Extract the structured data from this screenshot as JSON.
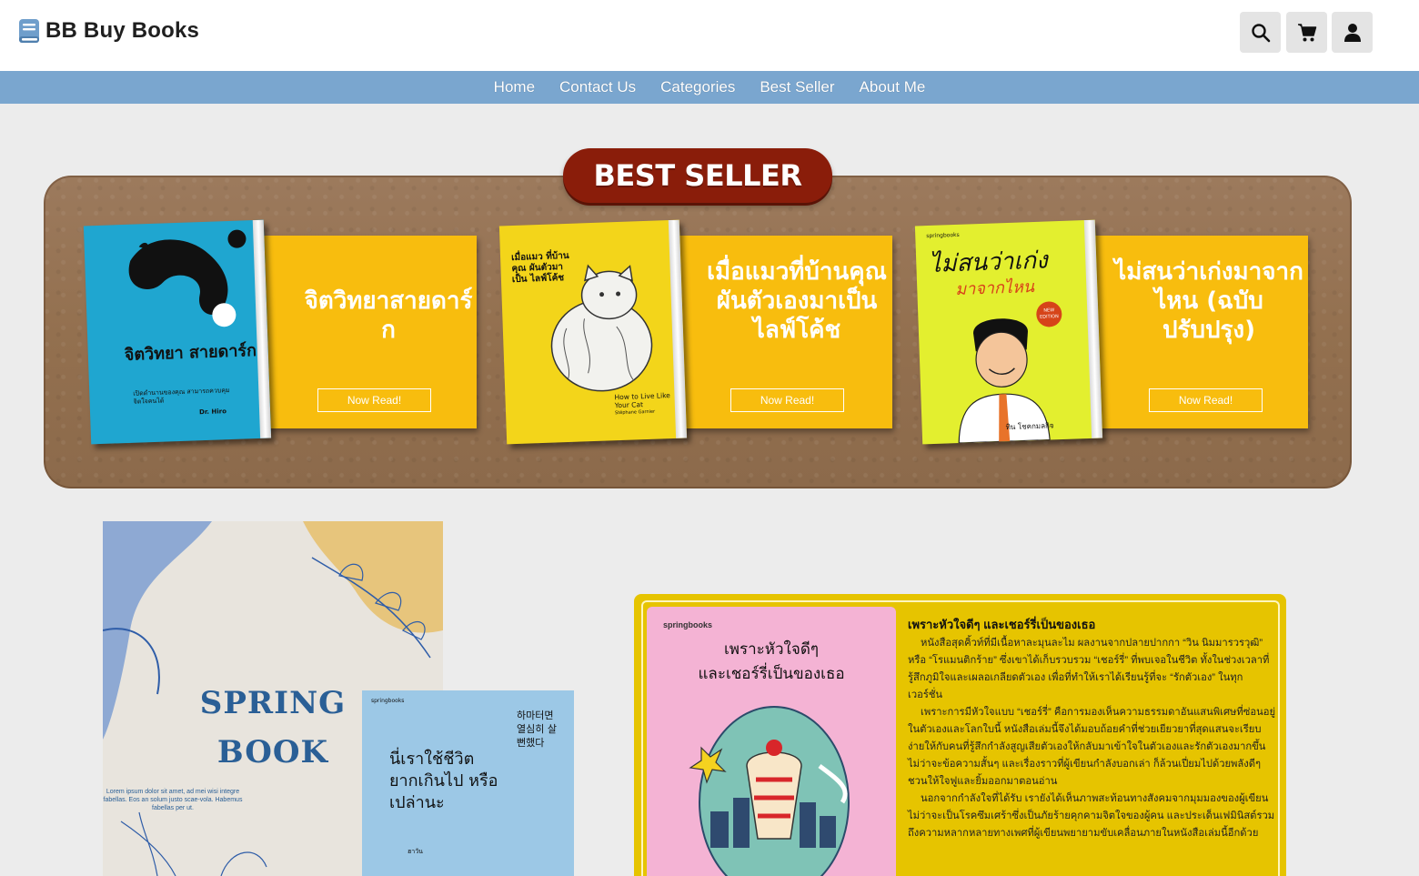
{
  "header": {
    "brand_title": "BB Buy Books",
    "icons": [
      "search-icon",
      "cart-icon",
      "user-icon"
    ]
  },
  "nav": {
    "items": [
      "Home",
      "Contact Us",
      "Categories",
      "Best Seller",
      "About Me"
    ]
  },
  "best_seller": {
    "badge": "BEST SELLER",
    "books": [
      {
        "title": "จิตวิทยาสายดาร์ก",
        "button": "Now Read!",
        "cover": {
          "title": "จิตวิทยา สายดาร์ก",
          "subtitle": "เปิดตำนานของคุณ สามารถควบคุมจิตใจคนได้",
          "author": "Dr. Hiro",
          "color": "#1fa6d0"
        }
      },
      {
        "title": "เมื่อแมวที่บ้านคุณผันตัวเองมาเป็นไลฟ์โค้ช",
        "button": "Now Read!",
        "cover": {
          "title": "เมื่อแมว ที่บ้านคุณ ผันตัวมาเป็น ไลฟ์โค้ช",
          "subtitle": "How to Live Like Your Cat",
          "author": "Stéphane Garnier",
          "color": "#f3d51a"
        }
      },
      {
        "title": "ไม่สนว่าเก่งมาจากไหน (ฉบับปรับปรุง)",
        "button": "Now Read!",
        "cover": {
          "title": "ไม่สนว่าเก่ง",
          "subtitle": "มาจากไหน",
          "publisher": "springbooks",
          "tag": "NEW EDITION",
          "author": "ทิน โชคกมลกิจ",
          "color": "#e3ef2f"
        }
      }
    ]
  },
  "spring_poster": {
    "title_line1": "SPRING",
    "title_line2": "BOOK",
    "description": "Lorem ipsum dolor sit amet, ad mei wisi integre fabellas. Eos an solum justo scae-vola. Habemus fabellas per ut.",
    "blue_book": {
      "publisher": "springbooks",
      "korean": "하마터면 열심히 살 뻔했다",
      "title": "นี่เราใช้ชีวิต ยากเกินไป หรือเปล่านะ",
      "author": "ฮาวัน"
    }
  },
  "feature": {
    "cover_publisher": "springbooks",
    "cover_title_line1": "เพราะหัวใจดีๆ",
    "cover_title_line2": "และเชอร์รี่เป็นของเธอ",
    "heading": "เพราะหัวใจดีๆ และเชอร์รี่เป็นของเธอ",
    "paragraphs": [
      "หนังสือสุดคิ้วท์ที่มีเนื้อหาละมุนละไม ผลงานจากปลายปากกา “วิน นิมมารวรวุฒิ” หรือ “โรแมนติกร้าย” ซึ่งเขาได้เก็บรวบรวม “เชอร์รี่” ที่พบเจอในชีวิต ทั้งในช่วงเวลาที่รู้สึกภูมิใจและเผลอเกลียดตัวเอง เพื่อที่ทำให้เราได้เรียนรู้ที่จะ “รักตัวเอง” ในทุกเวอร์ชั่น",
      "เพราะการมีหัวใจแบบ “เชอร์รี่” คือการมองเห็นความธรรมดาอันแสนพิเศษที่ซ่อนอยู่ในตัวเองและโลกใบนี้ หนังสือเล่มนี้จึงได้มอบถ้อยคำที่ช่วยเยียวยาที่สุดแสนจะเรียบง่ายให้กับคนที่รู้สึกกำลังสูญเสียตัวเองให้กลับมาเข้าใจในตัวเองและรักตัวเองมากขึ้น ไม่ว่าจะข้อความสั้นๆ และเรื่องราวที่ผู้เขียนกำลังบอกเล่า ก็ล้วนเปี่ยมไปด้วยพลังดีๆ ชวนให้ใจฟูและยิ้มออกมาตอนอ่าน",
      "นอกจากกำลังใจที่ได้รับ เรายังได้เห็นภาพสะท้อนทางสังคมจากมุมมองของผู้เขียน ไม่ว่าจะเป็นโรคซึมเศร้าซึ่งเป็นภัยร้ายคุกคามจิตใจของผู้คน และประเด็นเฟมินิสต์รวมถึงความหลากหลายทางเพศที่ผู้เขียนพยายามขับเคลื่อนภายในหนังสือเล่มนี้อีกด้วย"
    ]
  },
  "colors": {
    "nav_bg": "#7aa6cf",
    "board_bg": "#93704f",
    "badge_bg": "#8a1d0a",
    "card_bg": "#f8bd0e",
    "feature_bg": "#e6c400"
  }
}
